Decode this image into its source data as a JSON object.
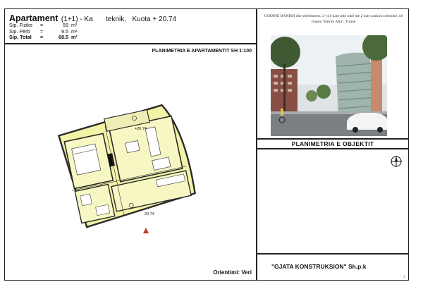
{
  "header": {
    "name": "Apartament",
    "type": "(1+1) - Ka",
    "floor_part_a": "teknik,",
    "floor_part_b": "Kuota + 20.74",
    "areas": [
      {
        "label": "Sip. Fizike",
        "eq": "=",
        "value": "59",
        "unit": "m²"
      },
      {
        "label": "Sip. Përb",
        "eq": "=",
        "value": "9.5",
        "unit": "m²"
      },
      {
        "label": "Sip. Total",
        "eq": "=",
        "value": "68.5",
        "unit": "m²"
      }
    ]
  },
  "plan": {
    "title": "PLANIMETRIA E APARTAMENTIT SH 1:100",
    "level_labels": [
      "+20.74",
      "20.74"
    ],
    "orientation": "Orientimi: Veri"
  },
  "project": {
    "description": "GODINË BANIMI dhe shërbimesh, 2+4,6 kate mbi tokë me 2 kate parkimi nëntokë, në rrugen \"Besim Alla\", Tiranë"
  },
  "object_plan": {
    "title": "PLANIMETRIA E OBJEKTIT"
  },
  "company": {
    "name": "\"GJATA KONSTRUKSION\" Sh.p.k",
    "page": "2"
  },
  "colors": {
    "frame": "#222222",
    "plan_fill": "#f3f3a8",
    "plan_wall": "#2a2a2a",
    "marker": "#c0392b"
  },
  "icons": {
    "compass": "north-arrow-icon",
    "entrance": "entrance-marker-icon"
  }
}
